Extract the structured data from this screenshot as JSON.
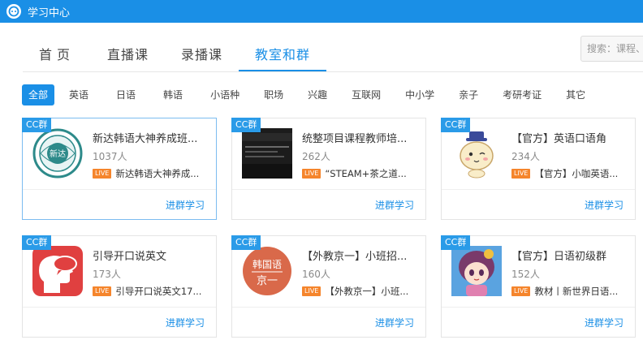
{
  "app": {
    "title": "学习中心"
  },
  "tabs": [
    {
      "label": "首页"
    },
    {
      "label": "直播课"
    },
    {
      "label": "录播课"
    },
    {
      "label": "教室和群"
    }
  ],
  "search": {
    "placeholder": "搜索：课程、"
  },
  "categories": [
    {
      "label": "全部"
    },
    {
      "label": "英语"
    },
    {
      "label": "日语"
    },
    {
      "label": "韩语"
    },
    {
      "label": "小语种"
    },
    {
      "label": "职场"
    },
    {
      "label": "兴趣"
    },
    {
      "label": "互联网"
    },
    {
      "label": "中小学"
    },
    {
      "label": "亲子"
    },
    {
      "label": "考研考证"
    },
    {
      "label": "其它"
    }
  ],
  "groups": [
    {
      "badge": "CC群",
      "name": "新达韩语大神养成班...",
      "count": "1037人",
      "live_tag": "LIVE",
      "live_text": "新达韩语大神养成...",
      "join": "进群学习"
    },
    {
      "badge": "CC群",
      "name": "统整项目课程教师培...",
      "count": "262人",
      "live_tag": "LIVE",
      "live_text": "“STEAM+茶之道...",
      "join": "进群学习"
    },
    {
      "badge": "CC群",
      "name": "【官方】英语口语角",
      "count": "234人",
      "live_tag": "LIVE",
      "live_text": "【官方】小咖英语...",
      "join": "进群学习"
    },
    {
      "badge": "CC群",
      "name": "引导开口说英文",
      "count": "173人",
      "live_tag": "LIVE",
      "live_text": "引导开口说英文17...",
      "join": "进群学习"
    },
    {
      "badge": "CC群",
      "name": "【外教京一】小班招...",
      "count": "160人",
      "live_tag": "LIVE",
      "live_text": "【外教京一】小班...",
      "join": "进群学习"
    },
    {
      "badge": "CC群",
      "name": "【官方】日语初级群",
      "count": "152人",
      "live_tag": "LIVE",
      "live_text": "教材丨新世界日语...",
      "join": "进群学习"
    }
  ],
  "thumbs": {
    "korean_logo_text": "新达",
    "jingyi_text_1": "韩国语",
    "jingyi_text_2": "京一"
  },
  "colors": {
    "accent": "#1a8fe6",
    "live": "#f5852c",
    "badge": "#2a9be8"
  }
}
